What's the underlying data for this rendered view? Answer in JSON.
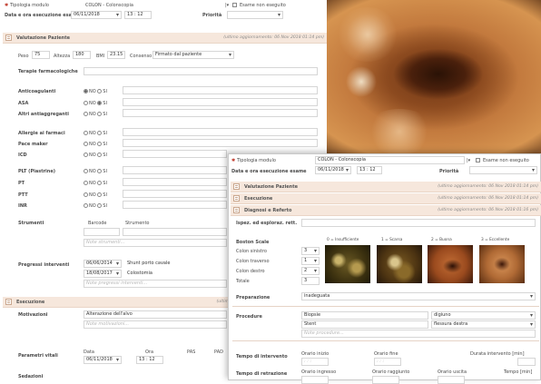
{
  "back": {
    "tipologia_label": "Tipologia modulo",
    "tipologia_value": "COLON - Colonscopia",
    "esame_non_eseguito": "Esame non eseguito",
    "data_ora_label": "Data e ora esecuzione esame",
    "date": "06/11/2018",
    "time": "13 : 12",
    "priorita_label": "Priorità",
    "valutazione_title": "Valutazione Paziente",
    "valutazione_updated": "(ultimo aggiornamento: 06 Nov 2018 01:14 pm)",
    "peso_label": "Peso",
    "peso_value": "75",
    "altezza_label": "Altezza",
    "altezza_value": "180",
    "bmi_label": "BMI",
    "bmi_value": "23.15",
    "consenso_label": "Consenso",
    "consenso_value": "Firmato dal paziente",
    "terapie_label": "Terapie farmacologiche",
    "no": "NO",
    "si": "SI",
    "anticoagulanti": "Anticoagulanti",
    "asa": "ASA",
    "altri_antiaggreganti": "Altri antiaggreganti",
    "allergie": "Allergie ai farmaci",
    "pacemaker": "Pace maker",
    "icd": "ICD",
    "plt": "PLT (Piastrine)",
    "pt": "PT",
    "ptt": "PTT",
    "inr": "INR",
    "strumenti_label": "Strumenti",
    "barcode_col": "Barcode",
    "strumento_col": "Strumento",
    "note_strumenti": "Note strumenti...",
    "pregressi_label": "Pregressi interventi",
    "preg1_date": "06/06/2014",
    "preg1_text": "Shunt porto cavale",
    "preg2_date": "18/08/2017",
    "preg2_text": "Colostomia",
    "note_pregressi": "Note pregressi interventi...",
    "esecuzione_title": "Esecuzione",
    "esecuzione_updated": "(ultim",
    "motivazioni_label": "Motivazioni",
    "motivazioni_value": "Alterazione dell'alvo",
    "note_motivazioni": "Note motivazioni...",
    "parametri_label": "Parametri vitali",
    "pv_data": "Data",
    "pv_ora": "Ora",
    "pv_pas": "PAS",
    "pv_pad": "PAD",
    "pv_date": "06/11/2018",
    "pv_time": "13 : 12",
    "sedazioni_label": "Sedazioni"
  },
  "front": {
    "tipologia_label": "Tipologia modulo",
    "tipologia_value": "COLON - Colonscopia",
    "esame_non_eseguito": "Esame non eseguito",
    "data_ora_label": "Data e ora esecuzione esame",
    "date": "06/11/2018",
    "time": "13 : 12",
    "priorita_label": "Priorità",
    "sections": [
      {
        "title": "Valutazione Paziente",
        "updated": "(ultimo aggiornamento: 06 Nov 2018 01:14 pm)"
      },
      {
        "title": "Esecuzione",
        "updated": "(ultimo aggiornamento: 06 Nov 2018 01:14 pm)"
      },
      {
        "title": "Diagnosi e Referto",
        "updated": "(ultimo aggiornamento: 06 Nov 2018 01:16 pm)"
      }
    ],
    "ispez_label": "Ispez. ed esploraz. rett.",
    "boston_label": "Boston Scale",
    "boston_scale_labels": [
      "0 = Insufficiente",
      "1 = Scarsa",
      "2 = Buona",
      "3 = Eccellente"
    ],
    "boston_rows": [
      {
        "label": "Colon sinistro",
        "value": "3"
      },
      {
        "label": "Colon traverso",
        "value": "1"
      },
      {
        "label": "Colon destro",
        "value": "2"
      },
      {
        "label": "Totale",
        "value": "3"
      }
    ],
    "preparazione_label": "Preparazione",
    "preparazione_value": "inadeguata",
    "procedure_label": "Procedure",
    "proc1": "Biopsie",
    "proc1_site": "digiuno",
    "proc2": "Stent",
    "proc2_site": "flessura destra",
    "note_procedure": "Note procedure...",
    "tempo_intervento_label": "Tempo di intervento",
    "orario_inizio": "Orario inizio",
    "orario_fine": "Orario fine",
    "durata_intervento": "Durata intervento [min]",
    "tempo_retrazione_label": "Tempo di retrazione",
    "orario_ingresso": "Orario ingresso",
    "orario_raggiunto": "Orario raggiunto",
    "orario_uscita": "Orario uscita",
    "tempo_min": "Tempo [min]",
    "time_placeholder": ": : :"
  },
  "colors": {
    "section_header": "#f6e7dc",
    "accent": "#c0392b"
  }
}
